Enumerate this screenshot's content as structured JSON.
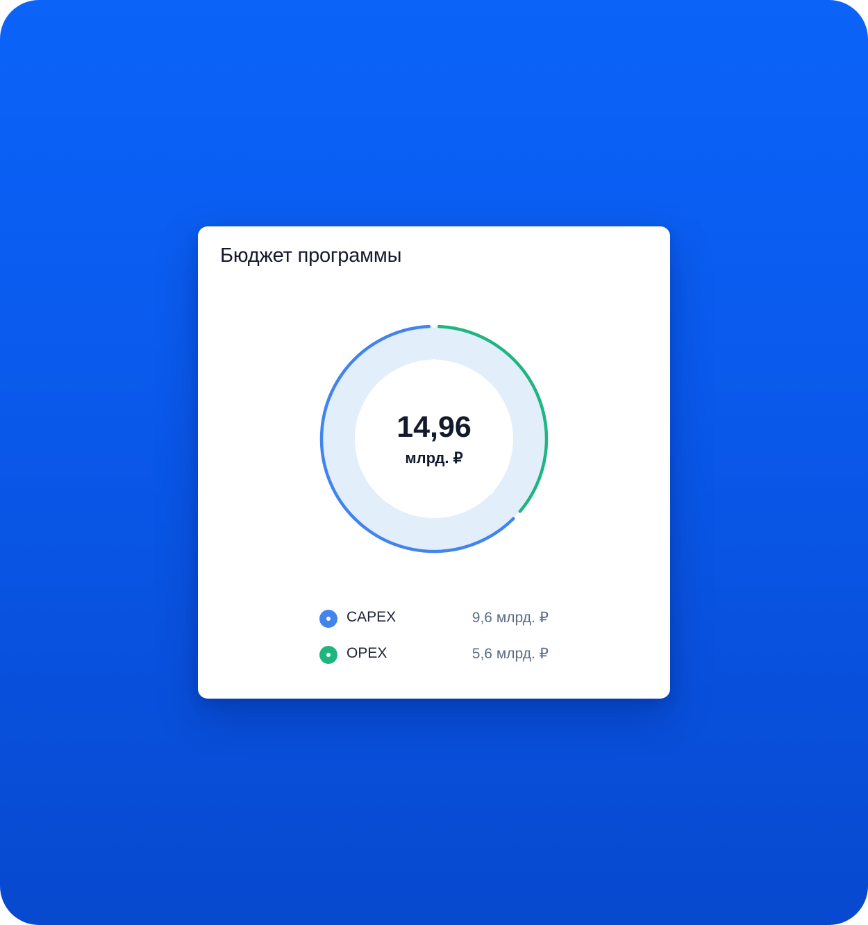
{
  "card": {
    "title": "Бюджет программы"
  },
  "chart_data": {
    "type": "pie",
    "title": "Бюджет программы",
    "total": "14,96",
    "total_unit": "млрд. ₽",
    "categories": [
      "CAPEX",
      "OPEX"
    ],
    "values": [
      9.6,
      5.6
    ],
    "value_labels": [
      "9,6 млрд. ₽",
      "5,6 млрд. ₽"
    ],
    "colors": [
      "#4184ee",
      "#1fb57f"
    ],
    "track_color": "#e2eef9",
    "legend_position": "bottom"
  },
  "legend": [
    {
      "name": "CAPEX",
      "value": "9,6 млрд. ₽",
      "color": "#4184ee"
    },
    {
      "name": "OPEX",
      "value": "5,6 млрд. ₽",
      "color": "#1fb57f"
    }
  ]
}
